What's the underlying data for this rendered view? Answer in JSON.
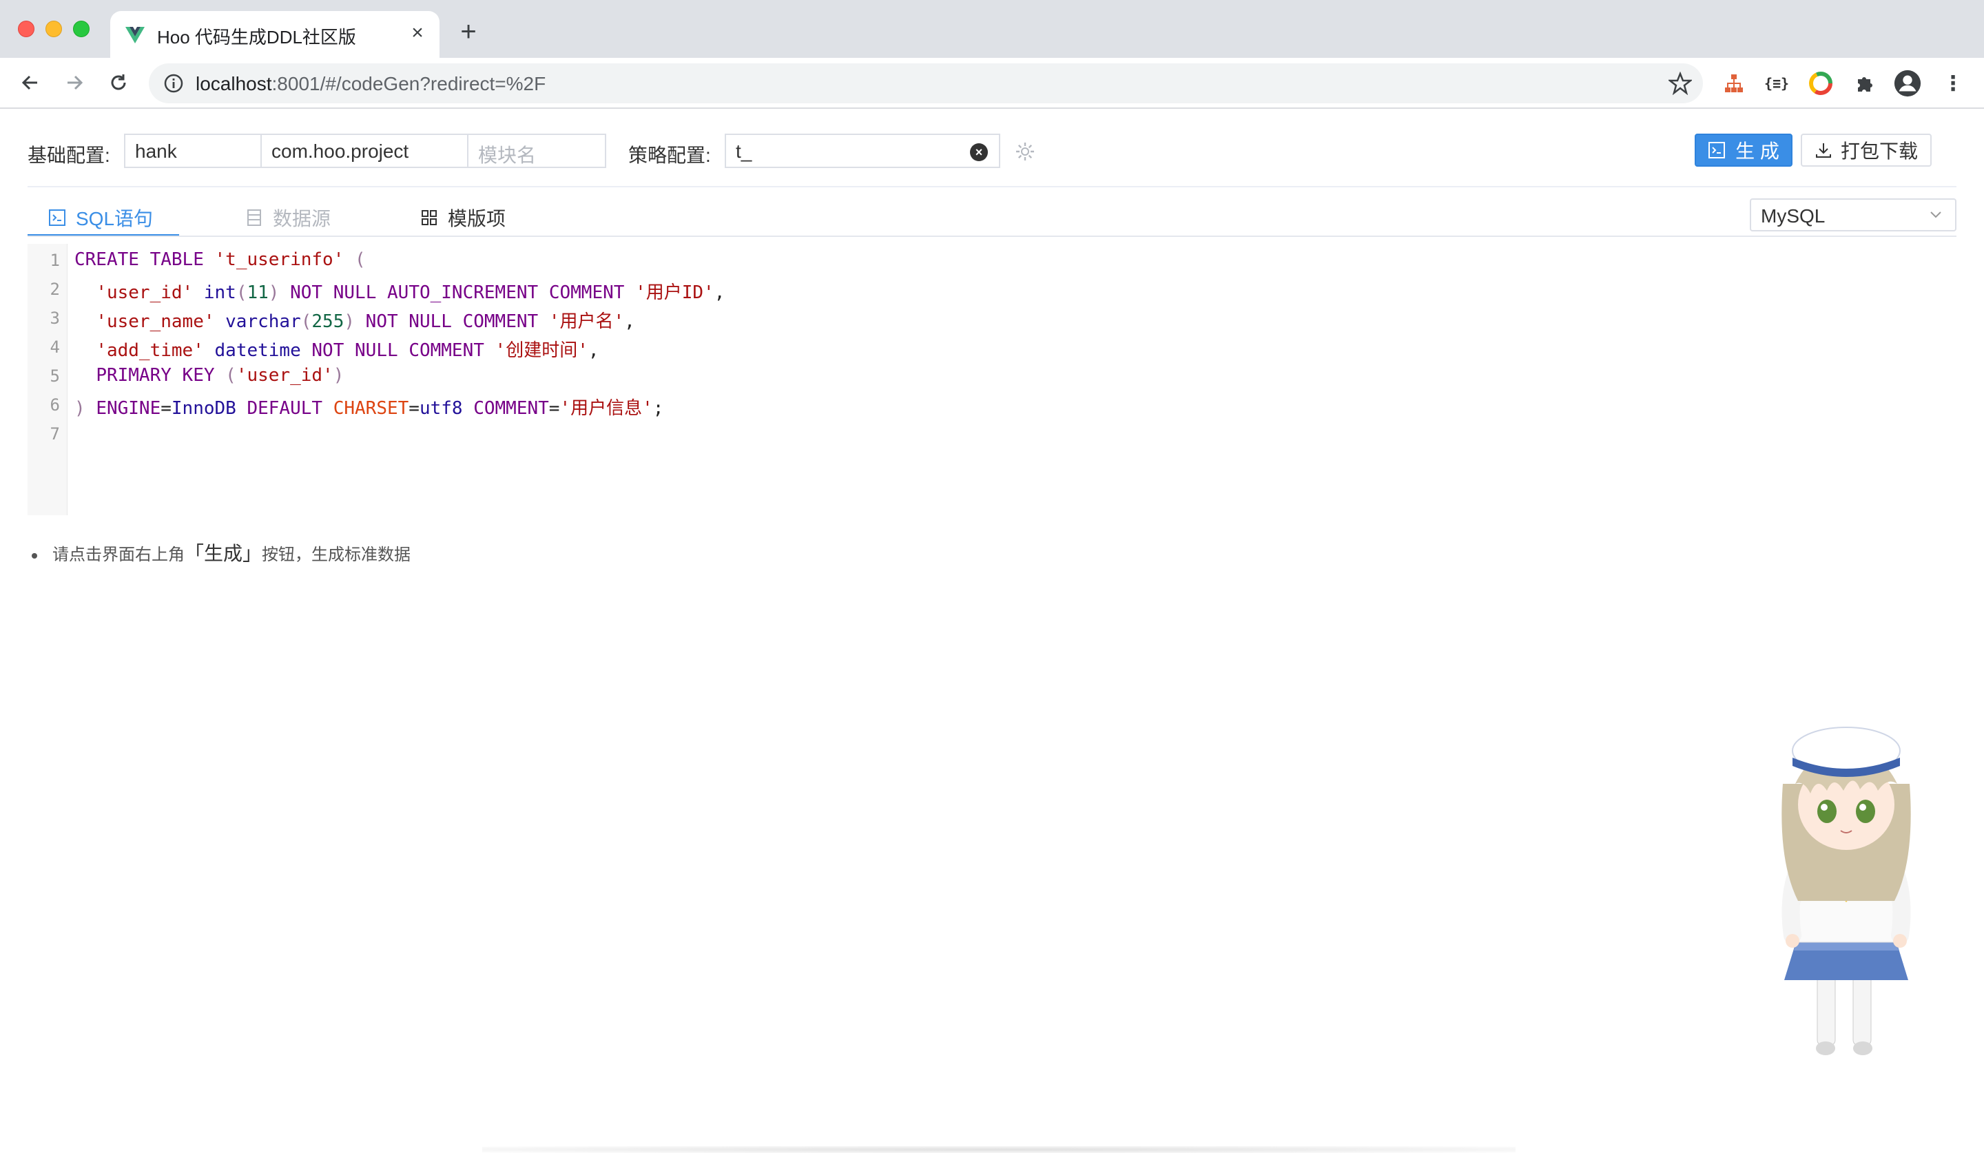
{
  "browser": {
    "tab_title": "Hoo 代码生成DDL社区版",
    "url_host": "localhost",
    "url_path": ":8001/#/codeGen?redirect=%2F"
  },
  "config": {
    "basic_label": "基础配置:",
    "author_value": "hank",
    "package_value": "com.hoo.project",
    "module_placeholder": "模块名",
    "strategy_label": "策略配置:",
    "prefix_value": "t_"
  },
  "actions": {
    "generate_label": "生 成",
    "download_label": "打包下载"
  },
  "tabs": [
    {
      "label": "SQL语句",
      "state": "active",
      "icon": "terminal-icon"
    },
    {
      "label": "数据源",
      "state": "disabled",
      "icon": "document-icon"
    },
    {
      "label": "模版项",
      "state": "normal",
      "icon": "grid-icon"
    }
  ],
  "db_select": {
    "value": "MySQL"
  },
  "editor": {
    "line_numbers": [
      "1",
      "2",
      "3",
      "4",
      "5",
      "6",
      "7"
    ],
    "lines": [
      "CREATE TABLE 't_userinfo' (",
      "  'user_id' int(11) NOT NULL AUTO_INCREMENT COMMENT '用户ID',",
      "  'user_name' varchar(255) NOT NULL COMMENT '用户名',",
      "  'add_time' datetime NOT NULL COMMENT '创建时间',",
      "  PRIMARY KEY ('user_id')",
      ") ENGINE=InnoDB DEFAULT CHARSET=utf8 COMMENT='用户信息';",
      ""
    ]
  },
  "tip": {
    "prefix": "请点击界面右上角",
    "highlight": "「生成」",
    "suffix": "按钮，生成标准数据"
  },
  "colors": {
    "primary": "#3a8ee6",
    "keyword": "#770088",
    "type": "#221199",
    "string": "#aa1111",
    "number": "#116644"
  }
}
